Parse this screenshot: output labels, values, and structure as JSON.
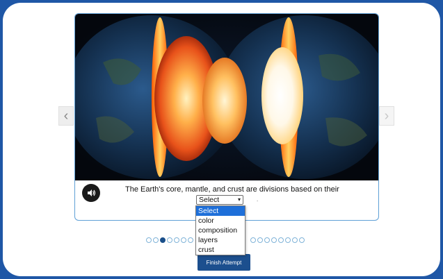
{
  "slide": {
    "image_alt": "Earth's layers cutaway illustration",
    "question_text": "The Earth's core, mantle, and crust are divisions based on their",
    "select": {
      "selected": "Select",
      "options": [
        "Select",
        "color",
        "composition",
        "layers",
        "crust"
      ],
      "highlighted_index": 0
    },
    "trailing_mark": "."
  },
  "navigation": {
    "prev_icon": "chevron-left-icon",
    "next_icon": "chevron-right-icon",
    "prev_glyph": "‹",
    "next_glyph": "›"
  },
  "pager": {
    "total": 22,
    "active_index": 2
  },
  "footer": {
    "finish_label": "Finish Attempt"
  },
  "colors": {
    "page_bg": "#1f57a6",
    "card_border": "#5e9fd6",
    "button_bg": "#1c4f8e",
    "dot_active": "#1a4f8a",
    "option_highlight": "#1e6fd9"
  }
}
